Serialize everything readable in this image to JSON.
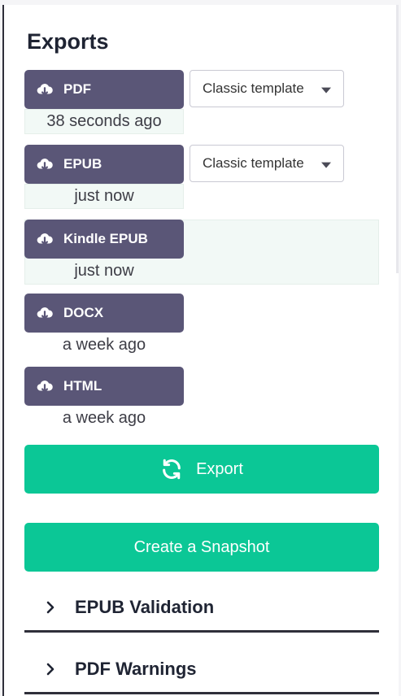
{
  "panel": {
    "title": "Exports"
  },
  "exports": [
    {
      "label": "PDF",
      "time": "38 seconds ago",
      "template": "Classic template"
    },
    {
      "label": "EPUB",
      "time": "just now",
      "template": "Classic template"
    },
    {
      "label": "Kindle EPUB",
      "time": "just now"
    },
    {
      "label": "DOCX",
      "time": "a week ago"
    },
    {
      "label": "HTML",
      "time": "a week ago"
    }
  ],
  "actions": {
    "export_label": "Export",
    "snapshot_label": "Create a Snapshot"
  },
  "sections": [
    {
      "label": "EPUB Validation"
    },
    {
      "label": "PDF Warnings"
    }
  ],
  "icons": {
    "download": "cloud-download-icon",
    "refresh": "refresh-icon",
    "chevron": "chevron-right-icon",
    "caret": "caret-down-icon"
  },
  "colors": {
    "export_button": "#5a5677",
    "accent_green": "#0bc796",
    "highlight_bg": "#f2f9f6"
  }
}
